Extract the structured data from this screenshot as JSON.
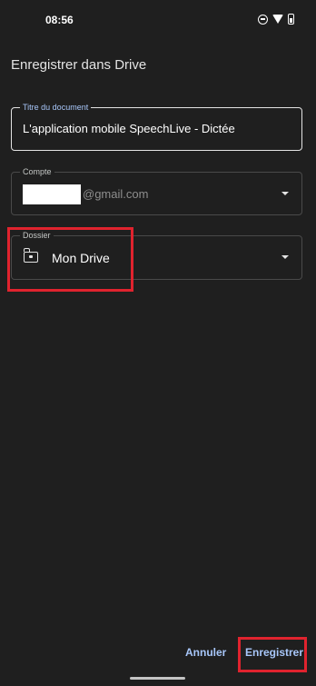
{
  "status_bar": {
    "time": "08:56",
    "icons": [
      "do-not-disturb-icon",
      "wifi-icon",
      "battery-icon"
    ]
  },
  "dialog": {
    "title": "Enregistrer dans Drive",
    "document_title": {
      "label": "Titre du document",
      "value": "L'application mobile SpeechLive - Dictée"
    },
    "account": {
      "label": "Compte",
      "value_suffix": "@gmail.com",
      "icon": "chevron-down-icon"
    },
    "folder": {
      "label": "Dossier",
      "value": "Mon Drive",
      "icon": "drive-folder-icon",
      "dropdown_icon": "chevron-down-icon"
    },
    "actions": {
      "cancel_label": "Annuler",
      "save_label": "Enregistrer"
    }
  },
  "colors": {
    "background": "#1f1f1f",
    "accent": "#a8c7fa",
    "highlight": "#e0232e",
    "text": "#e3e3e3"
  }
}
